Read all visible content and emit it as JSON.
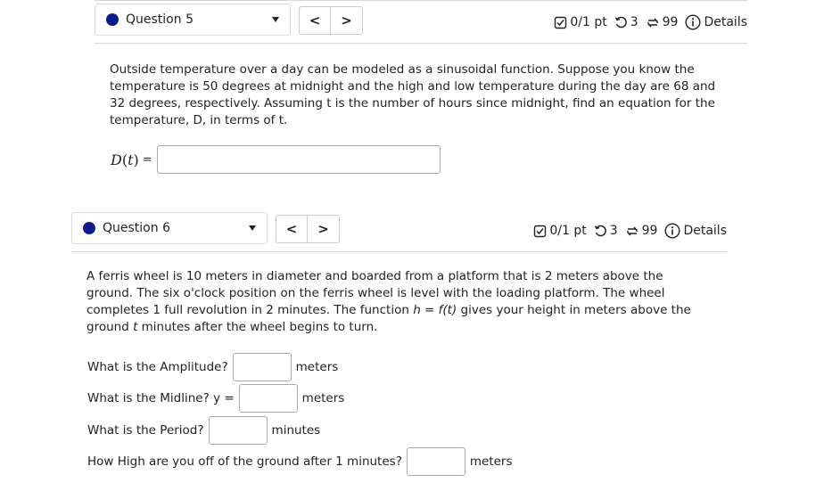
{
  "questions": [
    {
      "label": "Question 5",
      "nav": {
        "prev": "<",
        "next": ">"
      },
      "meta": {
        "points": "0/1 pt",
        "retries": "3",
        "submissions": "99",
        "details": "Details"
      },
      "text": "Outside temperature over a day can be modeled as a sinusoidal function. Suppose you know the temperature is 50 degrees at midnight and the high and low temperature during the day are 68 and 32 degrees, respectively. Assuming t is the number of hours since midnight, find an equation for the temperature, D, in terms of t.",
      "equation_label": "D",
      "equation_var": "t",
      "equation_equals": "=",
      "answer_value": ""
    },
    {
      "label": "Question 6",
      "nav": {
        "prev": "<",
        "next": ">"
      },
      "meta": {
        "points": "0/1 pt",
        "retries": "3",
        "submissions": "99",
        "details": "Details"
      },
      "text_parts": {
        "p1": "A ferris wheel is 10 meters in diameter and boarded from a platform that is 2 meters above the ground. The six o'clock position on the ferris wheel is level with the loading platform. The wheel completes 1 full revolution in 2 minutes. The function ",
        "h": "h",
        "eq": " = ",
        "ft": "f(t)",
        "p2": " gives your height in meters above the ground ",
        "t": "t",
        "p3": " minutes after the wheel begins to turn."
      },
      "subquestions": [
        {
          "prompt": "What is the Amplitude?",
          "unit": "meters",
          "value": ""
        },
        {
          "prompt": "What is the Midline? y =",
          "unit": "meters",
          "value": ""
        },
        {
          "prompt": "What is the Period?",
          "unit": "minutes",
          "value": ""
        },
        {
          "prompt": "How High are you off of the ground after 1 minutes?",
          "unit": "meters",
          "value": ""
        }
      ]
    }
  ],
  "colors": {
    "accent": "#0c1b8e",
    "border": "#d8d8d8",
    "text": "#222222"
  },
  "icons": {
    "points": "checkbox-icon",
    "retries": "retry-icon",
    "submissions": "submissions-icon",
    "details": "info-icon",
    "status": "status-dot"
  }
}
